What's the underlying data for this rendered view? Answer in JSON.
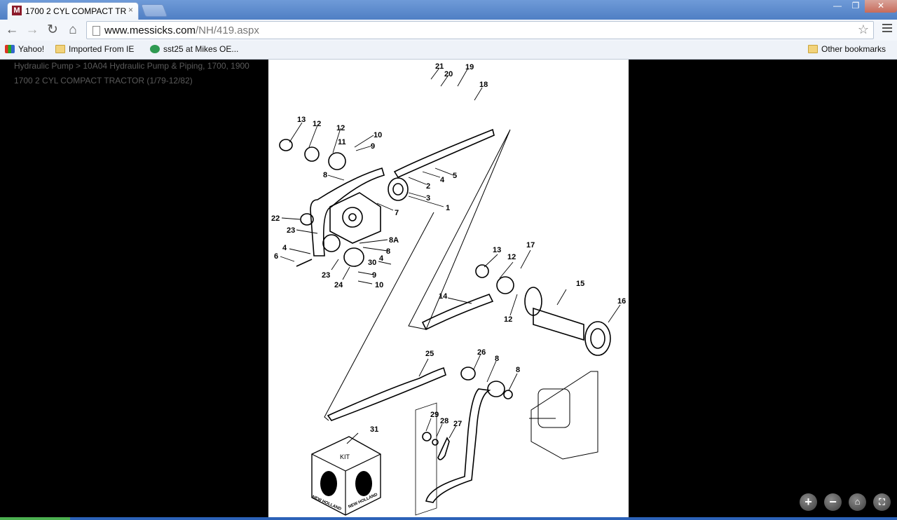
{
  "window": {
    "tab_title": "1700 2 CYL COMPACT TR",
    "tab_close": "×",
    "favicon_letter": "M",
    "minimize": "—",
    "restore": "❐",
    "close": "✕"
  },
  "toolbar": {
    "back": "←",
    "forward": "→",
    "reload": "↻",
    "home": "⌂",
    "url_domain": "www.messicks.com",
    "url_path": "/NH/419.aspx",
    "star": "☆"
  },
  "bookmarks": {
    "items": [
      {
        "label": "Yahoo!",
        "icon": "yahoo-icon"
      },
      {
        "label": "Imported From IE",
        "icon": "folder-icon"
      },
      {
        "label": "sst25 at Mikes OE...",
        "icon": "globe-icon"
      }
    ],
    "other": "Other bookmarks"
  },
  "page": {
    "breadcrumb": "Hydraulic Pump > 10A04 Hydraulic Pump & Piping, 1700, 1900",
    "subtitle": "1700 2 CYL COMPACT TRACTOR (1/79-12/82)"
  },
  "diagram": {
    "labels": [
      "21",
      "20",
      "19",
      "18",
      "13",
      "12",
      "12",
      "11",
      "10",
      "9",
      "8",
      "5",
      "4",
      "2",
      "3",
      "1",
      "7",
      "22",
      "23",
      "8A",
      "8",
      "4",
      "6",
      "30",
      "4",
      "23",
      "24",
      "9",
      "10",
      "13",
      "12",
      "17",
      "15",
      "14",
      "12",
      "16",
      "25",
      "26",
      "8",
      "8",
      "29",
      "28",
      "27",
      "31"
    ],
    "kit_label": "KIT",
    "brand": "NEW HOLLAND"
  },
  "viewer_controls": [
    "zoom-in-icon",
    "zoom-out-icon",
    "home-icon",
    "fullscreen-icon"
  ],
  "colors": {
    "titlebar": "#5a88cc",
    "favicon": "#8b1a2b"
  }
}
